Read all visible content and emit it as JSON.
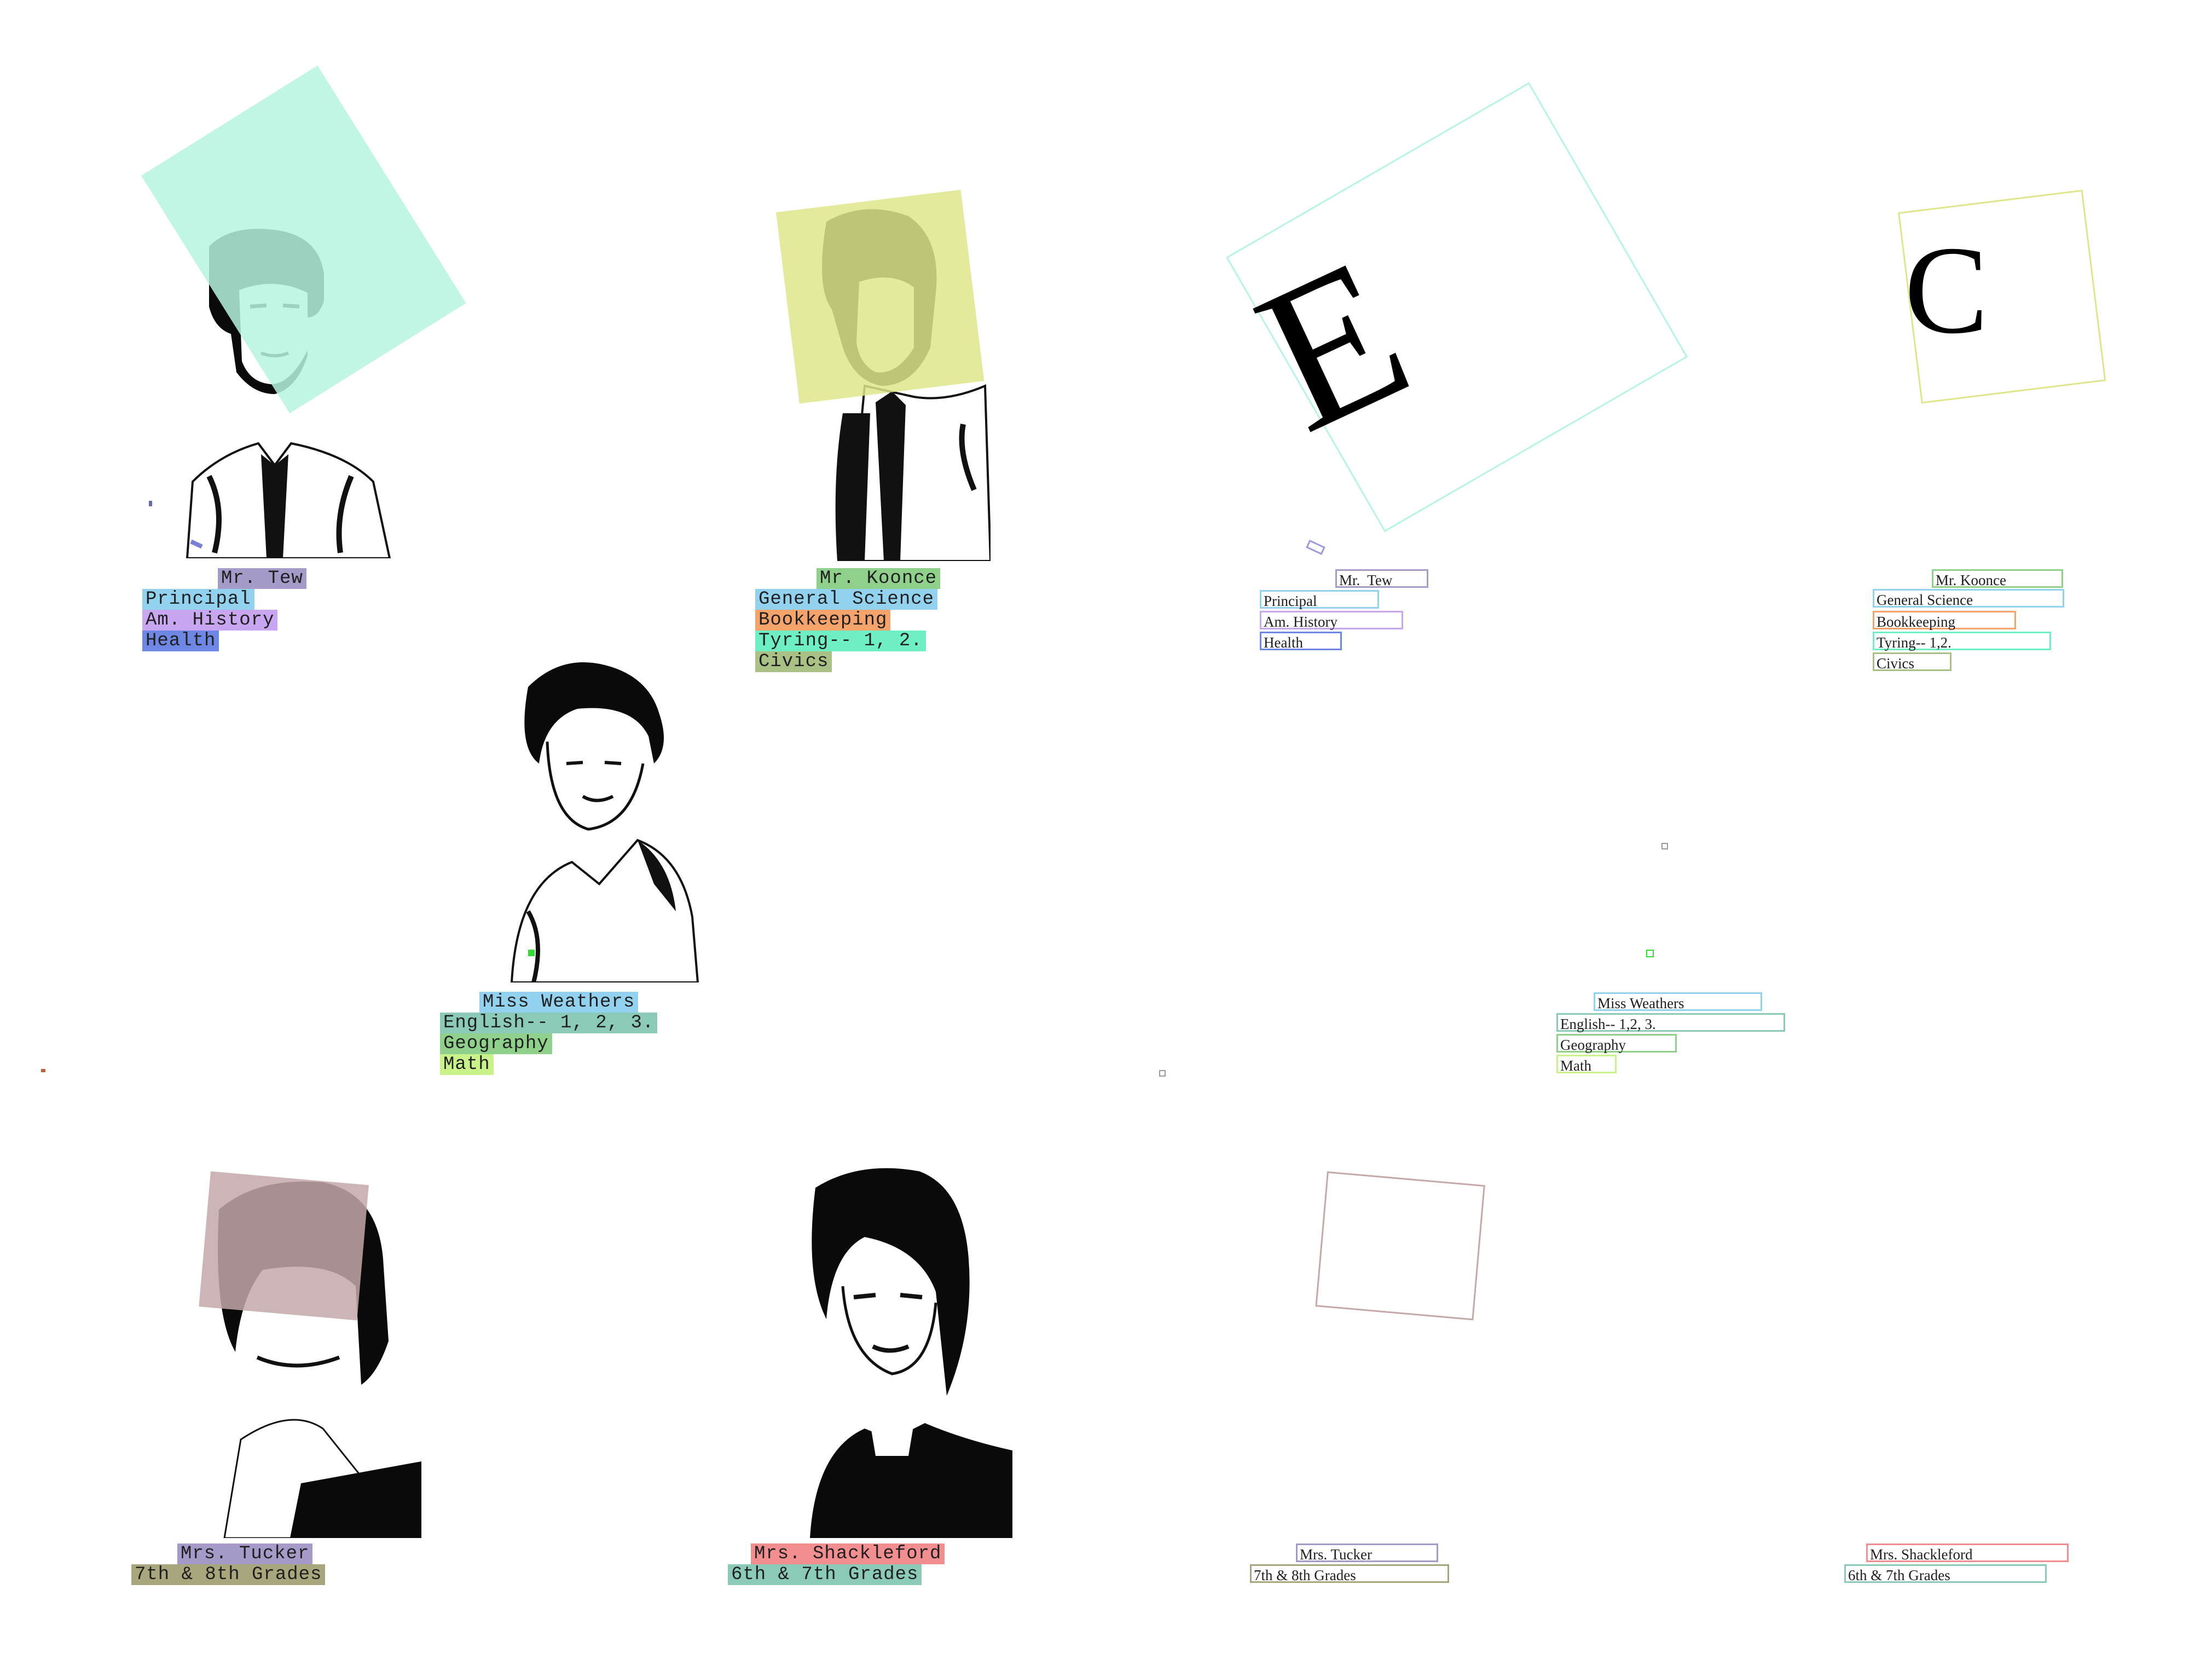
{
  "colors": {
    "teal_overlay": "#b6f5e0",
    "olive_overlay": "#dfe68a",
    "mauve_overlay": "#c4a8aa",
    "hl_purple": "#a69ac8",
    "hl_sky": "#93d2ee",
    "hl_lilac": "#c9a7f0",
    "hl_blue": "#6f87e4",
    "hl_green": "#8fd08a",
    "hl_orange": "#f4a36a",
    "hl_mint": "#6ff0c4",
    "hl_sage": "#a9c184",
    "hl_teal": "#8ccab8",
    "hl_lime": "#c9f28a",
    "hl_pink": "#f08e90",
    "hl_khaki": "#a8a67c"
  },
  "left_panel": {
    "tew": {
      "name": "Mr. Tew",
      "lines": [
        "Principal",
        "Am. History",
        "Health"
      ]
    },
    "koonce": {
      "name": "Mr. Koonce",
      "lines": [
        "General Science",
        "Bookkeeping",
        "Tyring-- 1, 2.",
        "Civics"
      ]
    },
    "weathers": {
      "name": "Miss Weathers",
      "lines": [
        "English-- 1, 2, 3.",
        "Geography",
        "Math"
      ]
    },
    "tucker": {
      "name": "Mrs. Tucker",
      "lines": [
        "7th & 8th Grades"
      ]
    },
    "shackleford": {
      "name": "Mrs. Shackleford",
      "lines": [
        "6th & 7th Grades"
      ]
    }
  },
  "right_panel": {
    "letter_e": "E",
    "letter_c": "C",
    "tew": {
      "name": "Mr.  Tew",
      "lines": [
        "Principal",
        "Am. History",
        "Health"
      ]
    },
    "koonce": {
      "name": "Mr. Koonce",
      "lines": [
        "General Science",
        "Bookkeeping",
        "Tyring-- 1,2.",
        "Civics"
      ]
    },
    "weathers": {
      "name": "Miss Weathers",
      "lines": [
        "English-- 1,2, 3.",
        "Geography",
        "Math"
      ]
    },
    "tucker": {
      "name": "Mrs. Tucker",
      "lines": [
        "7th & 8th Grades"
      ]
    },
    "shackleford": {
      "name": "Mrs. Shackleford",
      "lines": [
        "6th & 7th Grades"
      ]
    }
  }
}
